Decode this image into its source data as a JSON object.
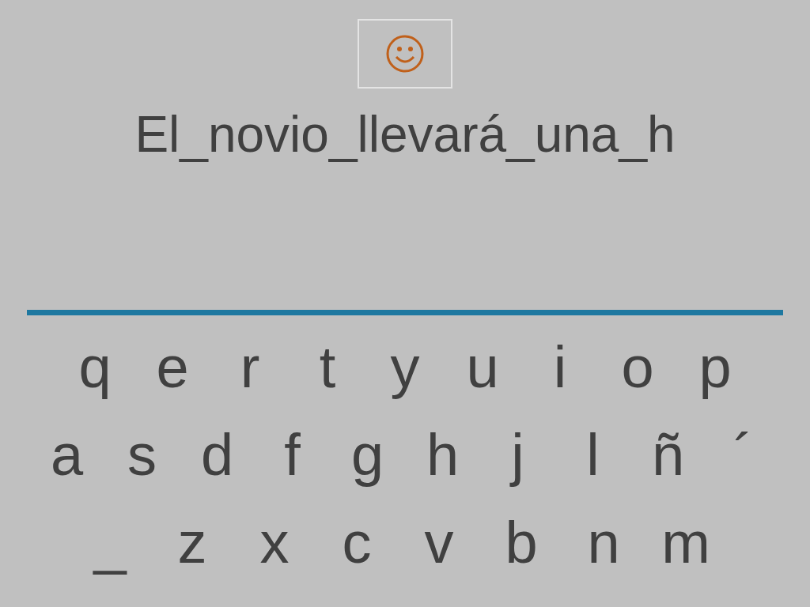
{
  "sentence": "El_novio_llevará_una_h",
  "keyboard": {
    "rows": [
      [
        "q",
        "e",
        "r",
        "t",
        "y",
        "u",
        "i",
        "o",
        "p"
      ],
      [
        "a",
        "s",
        "d",
        "f",
        "g",
        "h",
        "j",
        "l",
        "ñ",
        "´"
      ],
      [
        "_",
        "z",
        "x",
        "c",
        "v",
        "b",
        "n",
        "m"
      ]
    ]
  }
}
